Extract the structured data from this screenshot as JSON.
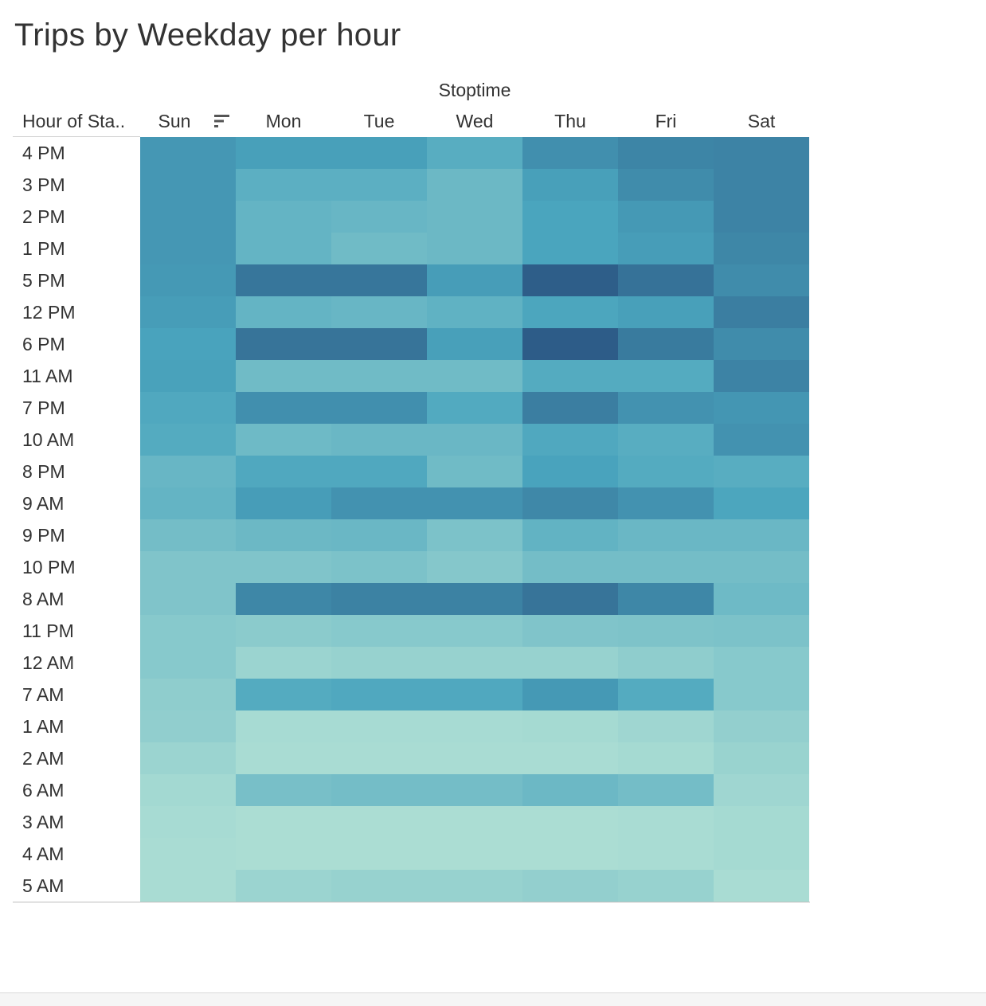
{
  "chart_data": {
    "type": "heatmap",
    "title": "Trips by Weekday per hour",
    "column_group_label": "Stoptime",
    "row_header": "Hour of Sta..",
    "columns": [
      "Sun",
      "Mon",
      "Tue",
      "Wed",
      "Thu",
      "Fri",
      "Sat"
    ],
    "rows": [
      "4 PM",
      "3 PM",
      "2 PM",
      "1 PM",
      "5 PM",
      "12 PM",
      "6 PM",
      "11 AM",
      "7 PM",
      "10 AM",
      "8 PM",
      "9 AM",
      "9 PM",
      "10 PM",
      "8 AM",
      "11 PM",
      "12 AM",
      "7 AM",
      "1 AM",
      "2 AM",
      "6 AM",
      "3 AM",
      "4 AM",
      "5 AM"
    ],
    "values": [
      [
        0.63,
        0.58,
        0.58,
        0.48,
        0.68,
        0.74,
        0.75
      ],
      [
        0.63,
        0.46,
        0.46,
        0.38,
        0.58,
        0.7,
        0.75
      ],
      [
        0.63,
        0.42,
        0.4,
        0.38,
        0.55,
        0.62,
        0.75
      ],
      [
        0.63,
        0.42,
        0.36,
        0.38,
        0.55,
        0.6,
        0.73
      ],
      [
        0.62,
        0.83,
        0.83,
        0.6,
        0.97,
        0.85,
        0.7
      ],
      [
        0.6,
        0.42,
        0.4,
        0.44,
        0.54,
        0.58,
        0.78
      ],
      [
        0.56,
        0.84,
        0.84,
        0.58,
        0.98,
        0.8,
        0.7
      ],
      [
        0.57,
        0.36,
        0.36,
        0.36,
        0.5,
        0.5,
        0.75
      ],
      [
        0.52,
        0.68,
        0.68,
        0.51,
        0.78,
        0.66,
        0.64
      ],
      [
        0.5,
        0.37,
        0.39,
        0.39,
        0.52,
        0.48,
        0.66
      ],
      [
        0.4,
        0.52,
        0.52,
        0.36,
        0.56,
        0.5,
        0.48
      ],
      [
        0.42,
        0.6,
        0.66,
        0.66,
        0.72,
        0.66,
        0.54
      ],
      [
        0.34,
        0.38,
        0.39,
        0.3,
        0.43,
        0.39,
        0.39
      ],
      [
        0.28,
        0.28,
        0.3,
        0.25,
        0.34,
        0.34,
        0.34
      ],
      [
        0.28,
        0.73,
        0.76,
        0.76,
        0.84,
        0.73,
        0.37
      ],
      [
        0.24,
        0.22,
        0.24,
        0.24,
        0.28,
        0.29,
        0.3
      ],
      [
        0.24,
        0.14,
        0.16,
        0.16,
        0.16,
        0.2,
        0.24
      ],
      [
        0.2,
        0.5,
        0.52,
        0.52,
        0.62,
        0.5,
        0.24
      ],
      [
        0.19,
        0.08,
        0.08,
        0.08,
        0.09,
        0.12,
        0.18
      ],
      [
        0.14,
        0.07,
        0.07,
        0.07,
        0.07,
        0.09,
        0.15
      ],
      [
        0.1,
        0.32,
        0.34,
        0.34,
        0.38,
        0.34,
        0.12
      ],
      [
        0.08,
        0.06,
        0.06,
        0.06,
        0.06,
        0.07,
        0.09
      ],
      [
        0.07,
        0.06,
        0.06,
        0.06,
        0.06,
        0.07,
        0.09
      ],
      [
        0.07,
        0.14,
        0.16,
        0.16,
        0.18,
        0.16,
        0.07
      ]
    ],
    "value_scale": [
      0,
      1
    ],
    "color_range": [
      "#b7e4d6",
      "#2c5985"
    ]
  }
}
